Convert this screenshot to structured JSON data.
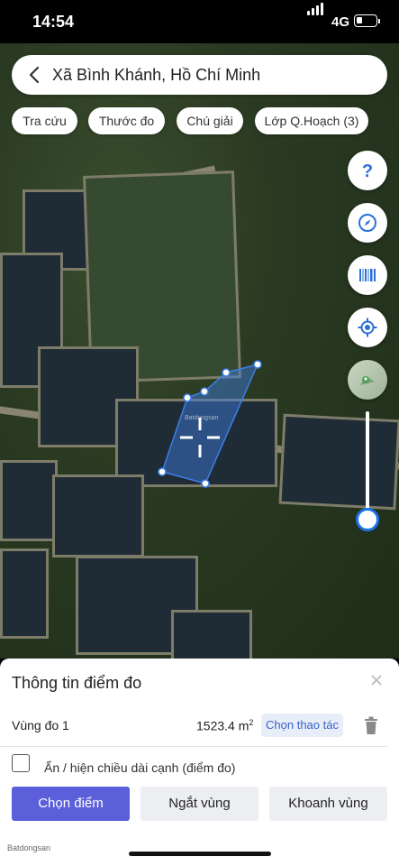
{
  "status_bar": {
    "time": "14:54",
    "network": "4G"
  },
  "search": {
    "location": "Xã Bình Khánh, Hồ Chí Minh"
  },
  "chips": [
    "Tra cứu",
    "Thước đo",
    "Chú giải",
    "Lớp Q.Hoạch (3)"
  ],
  "fab_icons": [
    "help-icon",
    "compass-icon",
    "barcode-icon",
    "locate-icon",
    "layers-icon"
  ],
  "map": {
    "watermark": "Batdongsan"
  },
  "panel": {
    "title": "Thông tin điểm đo",
    "area_label": "Vùng đo 1",
    "area_value": "1523.4 m",
    "area_unit_sup": "2",
    "action_label": "Chọn thao tác",
    "checkbox_label": "Ẩn / hiện chiều dài cạnh (điểm đo)",
    "buttons": [
      "Chọn điểm",
      "Ngắt vùng",
      "Khoanh vùng"
    ]
  },
  "footer": {
    "brand": "Batdongsan"
  },
  "colors": {
    "primary": "#5b5fd9",
    "polygon": "#3d7fe6",
    "accent": "#1a73e8"
  }
}
